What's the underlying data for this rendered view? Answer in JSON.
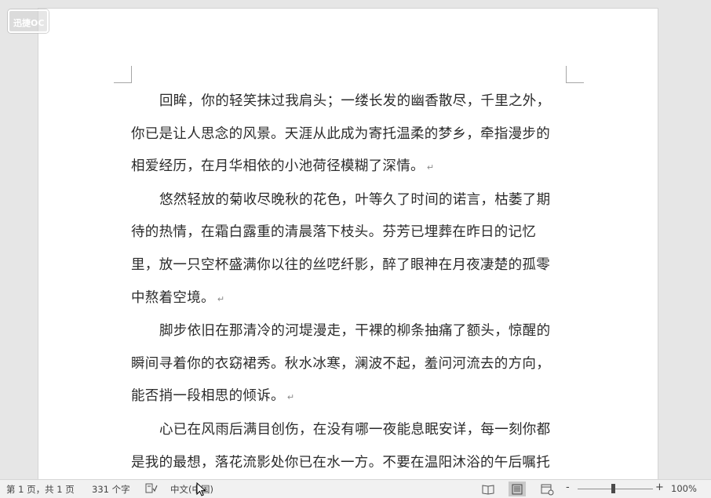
{
  "app": {
    "logo_text": "迅捷OC"
  },
  "document": {
    "paragraphs": [
      {
        "text": "回眸，你的轻笑抹过我肩头；一缕长发的幽香散尽，千里之外，你已是让人思念的风景。天涯从此成为寄托温柔的梦乡，牵指漫步的相爱经历，在月华相依的小池荷径模糊了深情。"
      },
      {
        "text": "悠然轻放的菊收尽晚秋的花色，叶等久了时间的诺言，枯萎了期待的热情，在霜白露重的清晨落下枝头。芬芳已埋葬在昨日的记忆里，放一只空杯盛满你以往的丝呓纤影，醉了眼神在月夜凄楚的孤零中熬着空境。"
      },
      {
        "text": "脚步依旧在那清冷的河堤漫走，干裸的柳条抽痛了额头，惊醒的瞬间寻着你的衣窈裙秀。秋水冰寒，澜波不起，羞问河流去的方向，能否捎一段相思的倾诉。"
      },
      {
        "text": "心已在风雨后满目创伤，在没有哪一夜能息眠安详，每一刻你都是我的最想，落花流影处你已在水一方。不要在温阳沐浴的午后嘱托"
      }
    ],
    "paragraph_mark": "↵"
  },
  "statusbar": {
    "page_info": "第 1 页，共 1 页",
    "word_count": "331 个字",
    "language": "中文(中国)",
    "zoom_minus": "-",
    "zoom_plus": "+",
    "zoom_level": "100%",
    "zoom_percent": 100,
    "icons": {
      "proofing": "proofing-icon",
      "read_mode": "read-mode-icon",
      "print_layout": "print-layout-icon",
      "web_layout": "web-layout-icon"
    }
  }
}
